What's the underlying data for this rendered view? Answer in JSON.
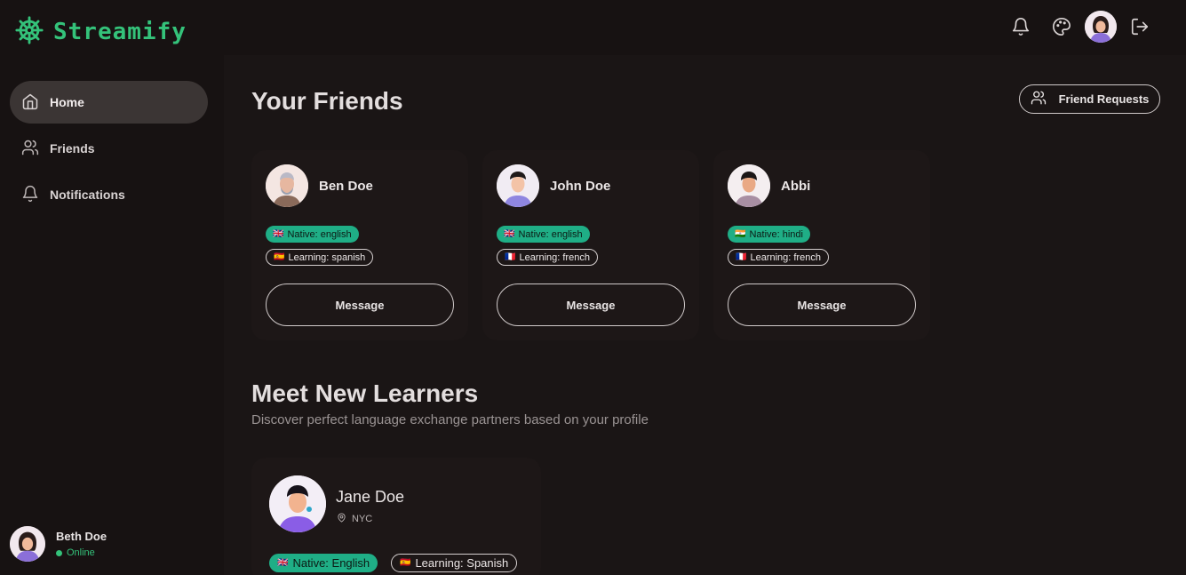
{
  "app": {
    "name": "Streamify"
  },
  "header": {
    "icons": [
      "bell-icon",
      "palette-icon",
      "avatar",
      "logout-icon"
    ]
  },
  "sidebar": {
    "items": [
      {
        "label": "Home",
        "icon": "home-icon",
        "active": true
      },
      {
        "label": "Friends",
        "icon": "users-icon",
        "active": false
      },
      {
        "label": "Notifications",
        "icon": "bell-icon",
        "active": false
      }
    ],
    "user": {
      "name": "Beth Doe",
      "status": "Online"
    }
  },
  "main": {
    "friends_title": "Your Friends",
    "friend_requests_label": "Friend Requests",
    "friends": [
      {
        "name": "Ben Doe",
        "native": "Native: english",
        "native_flag": "🇬🇧",
        "learning": "Learning: spanish",
        "learning_flag": "🇪🇸",
        "message_label": "Message"
      },
      {
        "name": "John Doe",
        "native": "Native: english",
        "native_flag": "🇬🇧",
        "learning": "Learning: french",
        "learning_flag": "🇫🇷",
        "message_label": "Message"
      },
      {
        "name": "Abbi",
        "native": "Native: hindi",
        "native_flag": "🇮🇳",
        "learning": "Learning: french",
        "learning_flag": "🇫🇷",
        "message_label": "Message"
      }
    ],
    "learners_title": "Meet New Learners",
    "learners_subtitle": "Discover perfect language exchange partners based on your profile",
    "learners": [
      {
        "name": "Jane Doe",
        "location": "NYC",
        "native": "Native: English",
        "native_flag": "🇬🇧",
        "learning": "Learning: Spanish",
        "learning_flag": "🇪🇸"
      }
    ]
  },
  "colors": {
    "accent": "#34c27a",
    "native_badge": "#1fae86",
    "background": "#171212",
    "active_nav": "#3b3534"
  }
}
